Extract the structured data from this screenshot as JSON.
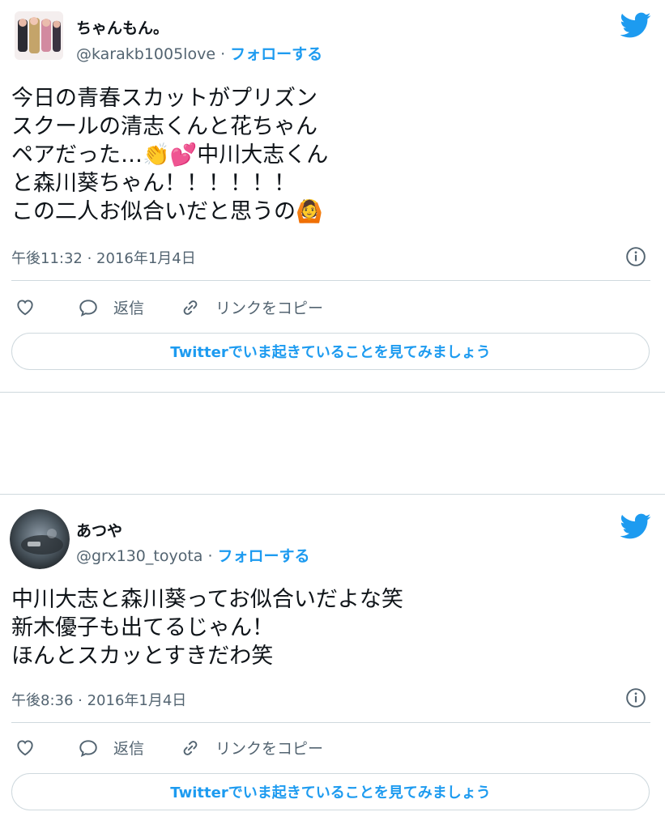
{
  "tweets": [
    {
      "user": {
        "name": "ちゃんもん。",
        "handle": "@karakb1005love",
        "separator": " · ",
        "follow_label": "フォローする"
      },
      "text_lines": [
        "今日の青春スカットがプリズン",
        "スクールの清志くんと花ちゃん",
        "ペアだった…👏💕中川大志くん",
        "と森川葵ちゃん！！！！！！",
        "この二人お似合いだと思うの🙆"
      ],
      "timestamp": "午後11:32 · 2016年1月4日",
      "actions": {
        "reply_label": "返信",
        "copy_link_label": "リンクをコピー"
      },
      "cta_label": "Twitterでいま起きていることを見てみましょう"
    },
    {
      "user": {
        "name": "あつや",
        "handle": "@grx130_toyota",
        "separator": " · ",
        "follow_label": "フォローする"
      },
      "text_lines": [
        "中川大志と森川葵ってお似合いだよな笑",
        "新木優子も出てるじゃん！",
        "ほんとスカッとすきだわ笑"
      ],
      "timestamp": "午後8:36 · 2016年1月4日",
      "actions": {
        "reply_label": "返信",
        "copy_link_label": "リンクをコピー"
      },
      "cta_label": "Twitterでいま起きていることを見てみましょう"
    }
  ],
  "icons": {
    "brand": "twitter-bird-icon",
    "info": "info-icon",
    "like": "heart-icon",
    "reply": "speech-bubble-icon",
    "copy_link": "link-icon"
  },
  "colors": {
    "accent": "#1d9bf0",
    "text": "#0f1419",
    "secondary_text": "#536471",
    "border": "#cfd9de"
  }
}
